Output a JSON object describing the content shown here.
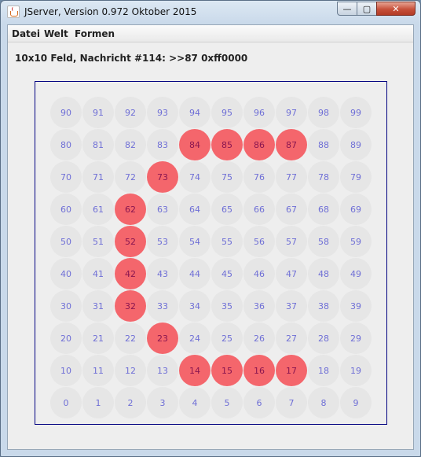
{
  "window": {
    "title": "JServer, Version 0.972 Oktober 2015",
    "buttons": {
      "minimize": "—",
      "maximize": "▢",
      "close": "✕"
    }
  },
  "menu": [
    "Datei",
    "Welt",
    "Formen"
  ],
  "status": "10x10 Feld, Nachricht #114: >>87 0xff0000",
  "board": {
    "columns": 10,
    "rows": 10,
    "numbering": "bottom-left origin, row-major",
    "default_color": "#e6e6e6",
    "highlight_color": "#f4666c",
    "highlighted_cells": [
      14,
      15,
      16,
      17,
      23,
      32,
      42,
      52,
      62,
      73,
      84,
      85,
      86,
      87
    ],
    "cell_labels": [
      "0",
      "1",
      "2",
      "3",
      "4",
      "5",
      "6",
      "7",
      "8",
      "9",
      "10",
      "11",
      "12",
      "13",
      "14",
      "15",
      "16",
      "17",
      "18",
      "19",
      "20",
      "21",
      "22",
      "23",
      "24",
      "25",
      "26",
      "27",
      "28",
      "29",
      "30",
      "31",
      "32",
      "33",
      "34",
      "35",
      "36",
      "37",
      "38",
      "39",
      "40",
      "41",
      "42",
      "43",
      "44",
      "45",
      "46",
      "47",
      "48",
      "49",
      "50",
      "51",
      "52",
      "53",
      "54",
      "55",
      "56",
      "57",
      "58",
      "59",
      "60",
      "61",
      "62",
      "63",
      "64",
      "65",
      "66",
      "67",
      "68",
      "69",
      "70",
      "71",
      "72",
      "73",
      "74",
      "75",
      "76",
      "77",
      "78",
      "79",
      "80",
      "81",
      "82",
      "83",
      "84",
      "85",
      "86",
      "87",
      "88",
      "89",
      "90",
      "91",
      "92",
      "93",
      "94",
      "95",
      "96",
      "97",
      "98",
      "99"
    ]
  }
}
